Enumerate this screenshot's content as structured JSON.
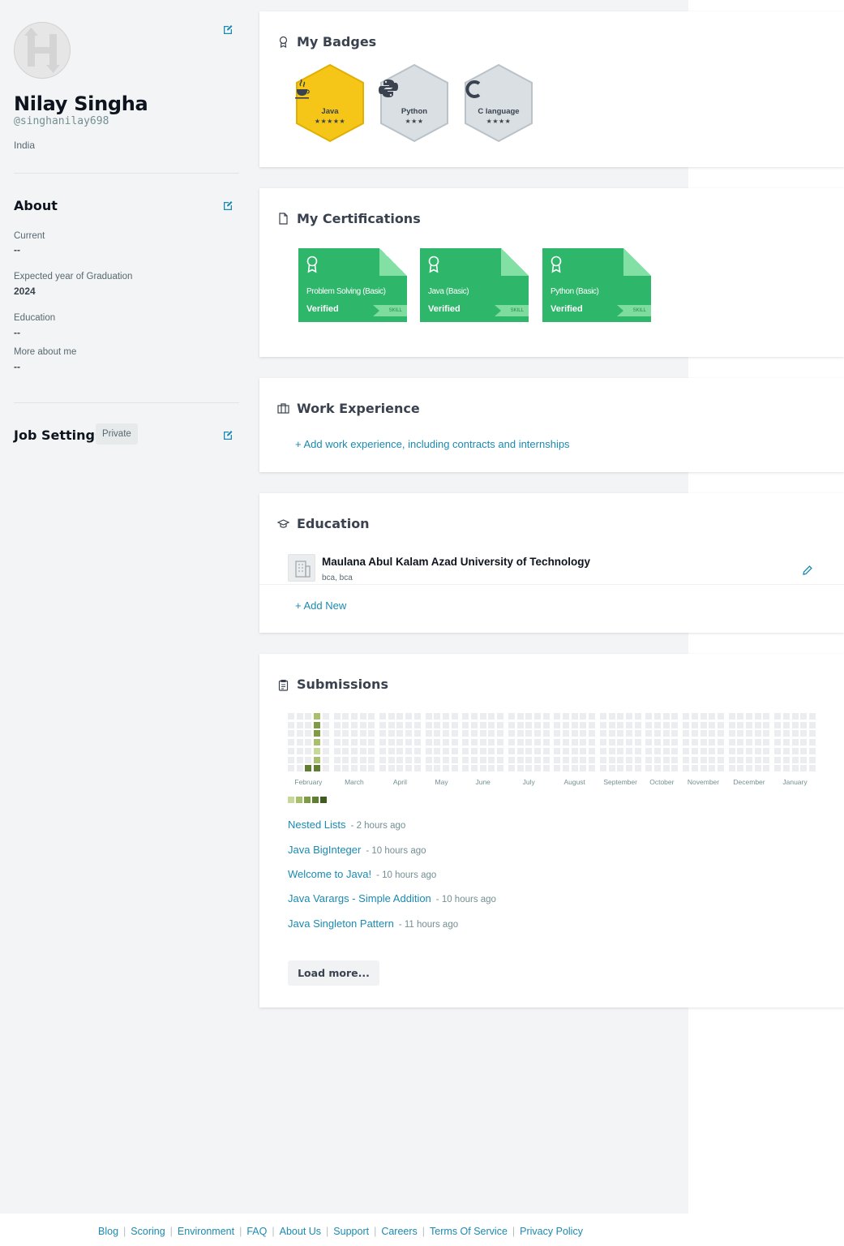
{
  "profile": {
    "name": "Nilay Singha",
    "handle": "@singhanilay698",
    "country": "India"
  },
  "about": {
    "title": "About",
    "fields": [
      {
        "label": "Current",
        "value": "--"
      },
      {
        "label": "Expected year of Graduation",
        "value": "2024"
      },
      {
        "label": "Education",
        "value": "--"
      },
      {
        "label": "More about me",
        "value": "--"
      }
    ]
  },
  "job_settings": {
    "title": "Job Settings",
    "privacy": "Private"
  },
  "badges": {
    "title": "My Badges",
    "items": [
      {
        "label": "Java",
        "stars": "★★★★★",
        "color": "#f5c518",
        "icon": "java-icon"
      },
      {
        "label": "Python",
        "stars": "★★★",
        "color": "#d9dfe3",
        "icon": "python-icon"
      },
      {
        "label": "C language",
        "stars": "★★★★",
        "color": "#d9dfe3",
        "icon": "c-icon"
      }
    ]
  },
  "certifications": {
    "title": "My Certifications",
    "items": [
      {
        "name": "Problem Solving (Basic)",
        "status": "Verified",
        "tag": "SKILL"
      },
      {
        "name": "Java (Basic)",
        "status": "Verified",
        "tag": "SKILL"
      },
      {
        "name": "Python (Basic)",
        "status": "Verified",
        "tag": "SKILL"
      }
    ],
    "color": "#2eb66a"
  },
  "work_experience": {
    "title": "Work Experience",
    "add_link": "+ Add work experience, including contracts and internships"
  },
  "education": {
    "title": "Education",
    "entries": [
      {
        "school": "Maulana Abul Kalam Azad University of Technology",
        "degree": "bca, bca"
      }
    ],
    "add_link": "+ Add New"
  },
  "submissions": {
    "title": "Submissions",
    "months": [
      "February",
      "March",
      "April",
      "May",
      "June",
      "July",
      "August",
      "September",
      "October",
      "November",
      "December",
      "January"
    ],
    "legend_colors": [
      "#c6d89a",
      "#a8c06c",
      "#7e9c45",
      "#5f7e2f",
      "#3f5b1e"
    ],
    "items": [
      {
        "title": "Nested Lists",
        "time": "- 2 hours ago"
      },
      {
        "title": "Java BigInteger",
        "time": "- 10 hours ago"
      },
      {
        "title": "Welcome to Java!",
        "time": "- 10 hours ago"
      },
      {
        "title": "Java Varargs - Simple Addition",
        "time": "- 10 hours ago"
      },
      {
        "title": "Java Singleton Pattern",
        "time": "- 11 hours ago"
      }
    ],
    "load_more": "Load more..."
  },
  "footer": {
    "links": [
      "Blog",
      "Scoring",
      "Environment",
      "FAQ",
      "About Us",
      "Support",
      "Careers",
      "Terms Of Service",
      "Privacy Policy"
    ]
  },
  "colors": {
    "link": "#1a8ab0",
    "page_background": "#f3f4f5"
  }
}
